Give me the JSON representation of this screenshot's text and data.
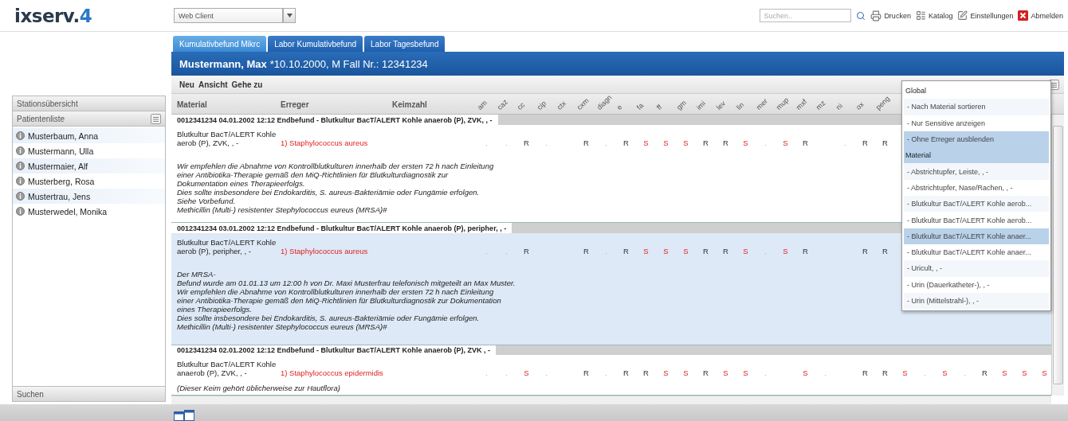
{
  "logo": {
    "name": "ixserv.",
    "version": "4"
  },
  "client_select": {
    "value": "Web Client"
  },
  "search": {
    "placeholder": "Suchen.."
  },
  "actions": [
    {
      "label": "Drucken",
      "kind": "print"
    },
    {
      "label": "Katalog",
      "kind": "catalog"
    },
    {
      "label": "Einstellungen",
      "kind": "settings"
    },
    {
      "label": "Abmelden",
      "kind": "logout"
    }
  ],
  "sidebar": {
    "sections": [
      "Stationsübersicht",
      "Patientenliste"
    ],
    "patients": [
      "Musterbaum, Anna",
      "Mustermann, Ulla",
      "Mustermaier, Alf",
      "Musterberg, Rosa",
      "Mustertrau, Jens",
      "Musterwedel, Monika"
    ],
    "footer": "Suchen"
  },
  "tabs": [
    {
      "label": "Kumulativbefund Mikrc",
      "selected": true
    },
    {
      "label": "Labor Kumulativbefund",
      "selected": false
    },
    {
      "label": "Labor Tagesbefund",
      "selected": false
    }
  ],
  "patient_bar": {
    "name": "Mustermann, Max",
    "details": "*10.10.2000, M Fall Nr.: 12341234"
  },
  "toolbar": [
    "Neu",
    "Ansicht",
    "Gehe zu"
  ],
  "table": {
    "columns": [
      "Material",
      "Erreger",
      "Keimzahl"
    ],
    "antibiotics": [
      "am",
      "caz",
      "cc",
      "cip",
      "ctx",
      "cxm",
      "diagn",
      "e",
      "fa",
      "ff",
      "gm",
      "imi",
      "lev",
      "lin",
      "mer",
      "mup",
      "mxf",
      "mz",
      "ni",
      "ox",
      "peng"
    ],
    "rows": [
      {
        "header": "0012341234  04.01.2002 12:12  Endbefund  -  Blutkultur BacT/ALERT Kohle anaerob (P), ZVK, , -",
        "selected": false,
        "material": [
          "Blutkultur BacT/ALERT Kohle",
          "aerob (P), ZVK, , -"
        ],
        "organism": "1) Staphylococcus aureus",
        "results": [
          {
            "text": ".",
            "kind": "dot"
          },
          {
            "text": ".",
            "kind": "dot"
          },
          {
            "text": "R",
            "kind": "resistant"
          },
          {
            "text": ".",
            "kind": "dot"
          },
          {
            "kind": "empty"
          },
          {
            "text": "R",
            "kind": "resistant"
          },
          {
            "text": ".",
            "kind": "dot"
          },
          {
            "text": "R",
            "kind": "resistant"
          },
          {
            "text": "S",
            "kind": "sensitive"
          },
          {
            "text": "S",
            "kind": "sensitive"
          },
          {
            "text": "S",
            "kind": "sensitive"
          },
          {
            "text": "R",
            "kind": "resistant"
          },
          {
            "text": "R",
            "kind": "resistant"
          },
          {
            "text": "S",
            "kind": "sensitive"
          },
          {
            "text": ".",
            "kind": "dot"
          },
          {
            "text": "S",
            "kind": "sensitive"
          },
          {
            "text": "R",
            "kind": "resistant"
          },
          {
            "kind": "empty"
          },
          {
            "text": ".",
            "kind": "dot"
          },
          {
            "text": "R",
            "kind": "resistant"
          },
          {
            "text": "R",
            "kind": "resistant"
          }
        ],
        "comment": [
          "Wir empfehlen die Abnahme von Kontrollblutkulturen innerhalb der ersten 72 h nach Einleitung",
          "einer Antibiotika-Therapie gemäß den MiQ-Richtlinien für Blutkulturdiagnostik zur",
          "Dokumentation eines Therapieerfolgs.",
          "Dies sollte insbesondere bei Endokarditis, S. aureus-Bakteriämie oder Fungämie erfolgen.",
          "Siehe Vorbefund.",
          "Methicillin (Multi-) resistenter Stephylococcus eureus (MRSA)#"
        ]
      },
      {
        "header": "0012341234  03.01.2002 12:12  Endbefund  -  Blutkultur BacT/ALERT Kohle anaerob (P), peripher, , -",
        "selected": true,
        "material": [
          "Blutkultur BacT/ALERT Kohle",
          "aerob (P), peripher, , -"
        ],
        "organism": "1) Staphylococcus aureus",
        "results": [
          {
            "text": ".",
            "kind": "dot"
          },
          {
            "text": ".",
            "kind": "dot"
          },
          {
            "text": "R",
            "kind": "resistant"
          },
          {
            "kind": "empty"
          },
          {
            "kind": "empty"
          },
          {
            "text": "R",
            "kind": "resistant"
          },
          {
            "text": ".",
            "kind": "dot"
          },
          {
            "text": "R",
            "kind": "resistant"
          },
          {
            "text": "S",
            "kind": "sensitive"
          },
          {
            "text": "S",
            "kind": "sensitive"
          },
          {
            "text": "S",
            "kind": "sensitive"
          },
          {
            "text": "R",
            "kind": "resistant"
          },
          {
            "text": "R",
            "kind": "resistant"
          },
          {
            "text": "S",
            "kind": "sensitive"
          },
          {
            "text": ".",
            "kind": "dot"
          },
          {
            "text": "S",
            "kind": "sensitive"
          },
          {
            "text": "R",
            "kind": "resistant"
          },
          {
            "kind": "empty"
          },
          {
            "kind": "empty"
          },
          {
            "text": "R",
            "kind": "resistant"
          },
          {
            "text": "R",
            "kind": "resistant"
          }
        ],
        "comment": [
          "Der MRSA-",
          "Befund wurde am 01.01.13 um 12:00 h von Dr. Maxi Musterfrau telefonisch mitgeteilt an Max Muster.",
          "Wir empfehlen die Abnahme von Kontrollblutkulturen innerhalb der ersten 72 h nach Einleitung",
          "einer Antibiotika-Therapie gemäß den MiQ-Richtlinien für Blutkulturdiagnostik zur Dokumentation",
          "eines Therapieerfolgs.",
          "Dies sollte insbesondere bei Endokarditis, S. aureus-Bakteriämie oder Fungämie erfolgen.",
          "Methicillin (Multi-) resistenter Stephylococcus eureus (MRSA)#"
        ]
      },
      {
        "header": "0012341234  02.01.2002 12:12  Endbefund  -  Blutkultur BacT/ALERT Kohle anaerob (P), ZVK , -",
        "selected": false,
        "material": [
          "Blutkultur BacT/ALERT Kohle",
          "anaerob (P), ZVK, , -"
        ],
        "organism": "1) Staphylococcus epidermidis",
        "results": [
          {
            "text": ".",
            "kind": "dot"
          },
          {
            "text": ".",
            "kind": "dot"
          },
          {
            "text": "S",
            "kind": "sensitive"
          },
          {
            "text": ".",
            "kind": "dot"
          },
          {
            "kind": "empty"
          },
          {
            "text": "R",
            "kind": "resistant"
          },
          {
            "text": ".",
            "kind": "dot"
          },
          {
            "text": "R",
            "kind": "resistant"
          },
          {
            "text": "R",
            "kind": "resistant"
          },
          {
            "text": "S",
            "kind": "sensitive"
          },
          {
            "text": "S",
            "kind": "sensitive"
          },
          {
            "text": "R",
            "kind": "resistant"
          },
          {
            "text": "S",
            "kind": "sensitive"
          },
          {
            "text": "S",
            "kind": "sensitive"
          },
          {
            "text": ".",
            "kind": "dot"
          },
          {
            "kind": "empty"
          },
          {
            "text": "S",
            "kind": "sensitive"
          },
          {
            "text": ".",
            "kind": "dot"
          },
          {
            "kind": "empty"
          },
          {
            "text": "R",
            "kind": "resistant"
          },
          {
            "text": "R",
            "kind": "resistant"
          },
          {
            "text": "S",
            "kind": "sensitive"
          },
          {
            "text": ".",
            "kind": "dot"
          },
          {
            "text": "S",
            "kind": "sensitive"
          },
          {
            "text": ".",
            "kind": "dot"
          },
          {
            "text": "R",
            "kind": "resistant"
          },
          {
            "text": "S",
            "kind": "sensitive"
          },
          {
            "text": "S",
            "kind": "sensitive"
          },
          {
            "text": "S",
            "kind": "sensitive"
          }
        ],
        "comment": [
          "(Dieser Keim gehört üblicherweise zur Hautflora)"
        ]
      }
    ]
  },
  "menu": {
    "items": [
      {
        "label": "Global",
        "kind": "heading",
        "selected": false
      },
      {
        "label": "- Nach Material sortieren",
        "kind": "option",
        "selected": false
      },
      {
        "label": "- Nur Sensitive anzeigen",
        "kind": "option",
        "selected": false
      },
      {
        "label": "- Ohne Erreger ausblenden",
        "kind": "option",
        "selected": true
      },
      {
        "label": "Material",
        "kind": "heading",
        "selected": true
      },
      {
        "label": "-  Abstrichtupfer, Leiste, , -",
        "kind": "option",
        "selected": false
      },
      {
        "label": "-  Abstrichtupfer, Nase/Rachen, , -",
        "kind": "option",
        "selected": false
      },
      {
        "label": "-  Blutkultur BacT/ALERT Kohle aerob...",
        "kind": "option",
        "selected": false
      },
      {
        "label": "-  Blutkultur BacT/ALERT Kohle aerob...",
        "kind": "option",
        "selected": false
      },
      {
        "label": "-  Blutkultur BacT/ALERT Kohle anaer...",
        "kind": "option",
        "selected": true
      },
      {
        "label": "-  Blutkultur BacT/ALERT Kohle anaer...",
        "kind": "option",
        "selected": false
      },
      {
        "label": "-  Uricult, , -",
        "kind": "option",
        "selected": false
      },
      {
        "label": "-  Urin (Dauerkatheter-), , -",
        "kind": "option",
        "selected": false
      },
      {
        "label": "-  Urin (Mittelstrahl-), , -",
        "kind": "option",
        "selected": false
      }
    ]
  }
}
